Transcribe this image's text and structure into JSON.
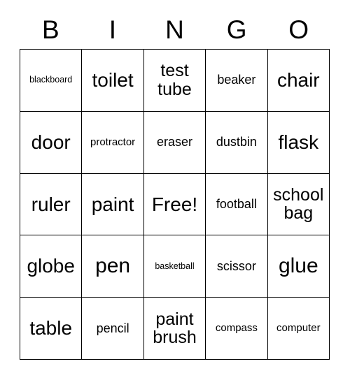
{
  "card": {
    "headers": [
      "B",
      "I",
      "N",
      "G",
      "O"
    ],
    "free_label": "Free!",
    "rows": [
      [
        {
          "text": "blackboard",
          "size": "fs-xxs"
        },
        {
          "text": "toilet",
          "size": "fs-lg"
        },
        {
          "text": "test tube",
          "size": "fs-md"
        },
        {
          "text": "beaker",
          "size": "fs-sm"
        },
        {
          "text": "chair",
          "size": "fs-lg"
        }
      ],
      [
        {
          "text": "door",
          "size": "fs-lg"
        },
        {
          "text": "protractor",
          "size": "fs-xs"
        },
        {
          "text": "eraser",
          "size": "fs-sm"
        },
        {
          "text": "dustbin",
          "size": "fs-sm"
        },
        {
          "text": "flask",
          "size": "fs-lg"
        }
      ],
      [
        {
          "text": "ruler",
          "size": "fs-lg"
        },
        {
          "text": "paint",
          "size": "fs-lg"
        },
        {
          "text": "Free!",
          "size": "fs-lg"
        },
        {
          "text": "football",
          "size": "fs-sm"
        },
        {
          "text": "school bag",
          "size": "fs-md"
        }
      ],
      [
        {
          "text": "globe",
          "size": "fs-lg"
        },
        {
          "text": "pen",
          "size": "fs-xl"
        },
        {
          "text": "basketball",
          "size": "fs-xxs"
        },
        {
          "text": "scissor",
          "size": "fs-sm"
        },
        {
          "text": "glue",
          "size": "fs-xl"
        }
      ],
      [
        {
          "text": "table",
          "size": "fs-lg"
        },
        {
          "text": "pencil",
          "size": "fs-sm"
        },
        {
          "text": "paint brush",
          "size": "fs-md"
        },
        {
          "text": "compass",
          "size": "fs-xs"
        },
        {
          "text": "computer",
          "size": "fs-xs"
        }
      ]
    ]
  },
  "colors": {
    "border": "#000000",
    "text": "#000000",
    "background": "#ffffff"
  }
}
